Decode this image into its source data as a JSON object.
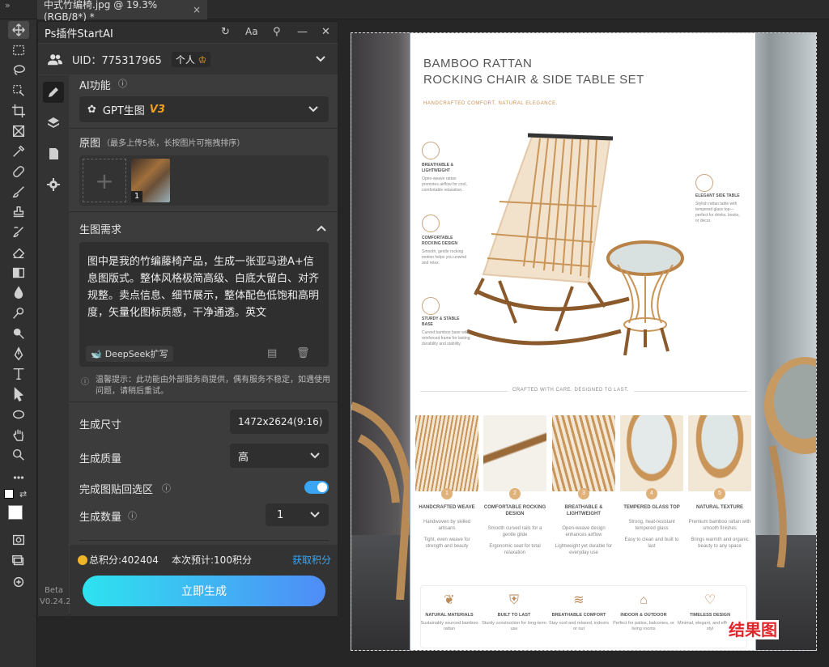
{
  "app": {
    "tab_title": "中式竹编椅.jpg @ 19.3%(RGB/8*) *",
    "tab_close": "×",
    "collapse": "»"
  },
  "plugin": {
    "title": "Ps插件StartAI",
    "header_icons": [
      "refresh-icon",
      "font-icon",
      "pin-icon",
      "minimize-icon",
      "close-icon"
    ],
    "aa_label": "Aa",
    "uid_label": "UID：775317965",
    "account_type": "个人",
    "ai_function_label": "AI功能",
    "ai_function_value": "GPT生图",
    "ai_function_version": "V3",
    "source_label": "原图",
    "source_hint": "（最多上传5张，长按图片可拖拽排序）",
    "thumb_index": "1",
    "prompt_label": "生图需求",
    "prompt_text": "图中是我的竹编藤椅产品，生成一张亚马逊A+信息图版式。整体风格极简高级、白底大留白、对齐规整。卖点信息、细节展示，整体配色低饱和高明度，矢量化图标质感，干净通透。英文",
    "deepseek_label": "DeepSeek扩写",
    "notice": "温馨提示：此功能由外部服务商提供，偶有服务不稳定，如遇使用问题，请稍后重试。",
    "size_label": "生成尺寸",
    "size_value": "1472x2624(9:16)",
    "quality_label": "生成质量",
    "quality_value": "高",
    "paste_back_label": "完成图贴回选区",
    "paste_back_on": true,
    "count_label": "生成数量",
    "count_value": "1",
    "points_label": "总积分:402404",
    "estimate_label": "本次预计:100积分",
    "get_points": "获取积分",
    "generate_button": "立即生成",
    "version_beta": "Beta",
    "version": "V0.24.2"
  },
  "canvas": {
    "result_label": "结果图",
    "card": {
      "title_line1": "BAMBOO RATTAN",
      "title_line2": "ROCKING CHAIR & SIDE TABLE SET",
      "tagline": "HANDCRAFTED COMFORT. NATURAL ELEGANCE.",
      "callouts": [
        {
          "title": "BREATHABLE & LIGHTWEIGHT",
          "text": "Open-weave rattan promotes airflow for cool, comfortable relaxation."
        },
        {
          "title": "COMFORTABLE ROCKING DESIGN",
          "text": "Smooth, gentle rocking motion helps you unwind and relax."
        },
        {
          "title": "STURDY & STABLE BASE",
          "text": "Curved bamboo base with reinforced frame for lasting durability and stability."
        },
        {
          "title": "ELEGANT SIDE TABLE",
          "text": "Stylish rattan table with tempered glass top—perfect for drinks, books, or decor."
        }
      ],
      "divider_text": "CRAFTED WITH CARE. DESIGNED TO LAST.",
      "features": [
        {
          "num": "1",
          "title": "HANDCRAFTED WEAVE",
          "b1": "Handwoven by skilled artisans",
          "b2": "Tight, even weave for strength and beauty"
        },
        {
          "num": "2",
          "title": "COMFORTABLE ROCKING DESIGN",
          "b1": "Smooth curved rails for a gentle glide",
          "b2": "Ergonomic seat for total relaxation"
        },
        {
          "num": "3",
          "title": "BREATHABLE & LIGHTWEIGHT",
          "b1": "Open-weave design enhances airflow",
          "b2": "Lightweight yet durable for everyday use"
        },
        {
          "num": "4",
          "title": "TEMPERED GLASS TOP",
          "b1": "Strong, heat-resistant tempered glass",
          "b2": "Easy to clean and built to last"
        },
        {
          "num": "5",
          "title": "NATURAL TEXTURE",
          "b1": "Premium bamboo rattan with smooth finishes",
          "b2": "Brings warmth and organic beauty to any space"
        }
      ],
      "bottom_icons": [
        {
          "icon": "leaf-icon",
          "title": "NATURAL MATERIALS",
          "text": "Sustainably sourced bamboo rattan"
        },
        {
          "icon": "shield-icon",
          "title": "BUILT TO LAST",
          "text": "Sturdy construction for long-term use"
        },
        {
          "icon": "wind-icon",
          "title": "BREATHABLE COMFORT",
          "text": "Stay cool and relaxed, indoors or out"
        },
        {
          "icon": "home-icon",
          "title": "INDOOR & OUTDOOR",
          "text": "Perfect for patios, balconies, or living rooms"
        },
        {
          "icon": "heart-icon",
          "title": "TIMELESS DESIGN",
          "text": "Minimal, elegant, and effortlessly styl"
        }
      ]
    }
  },
  "colors": {
    "accent": "#3aa6f3",
    "button_gradient_start": "#2ee3ef",
    "button_gradient_end": "#4f8cf7",
    "version_tag": "#f0a020",
    "points_link": "#3aa6f3",
    "result_label": "#e0262a"
  }
}
